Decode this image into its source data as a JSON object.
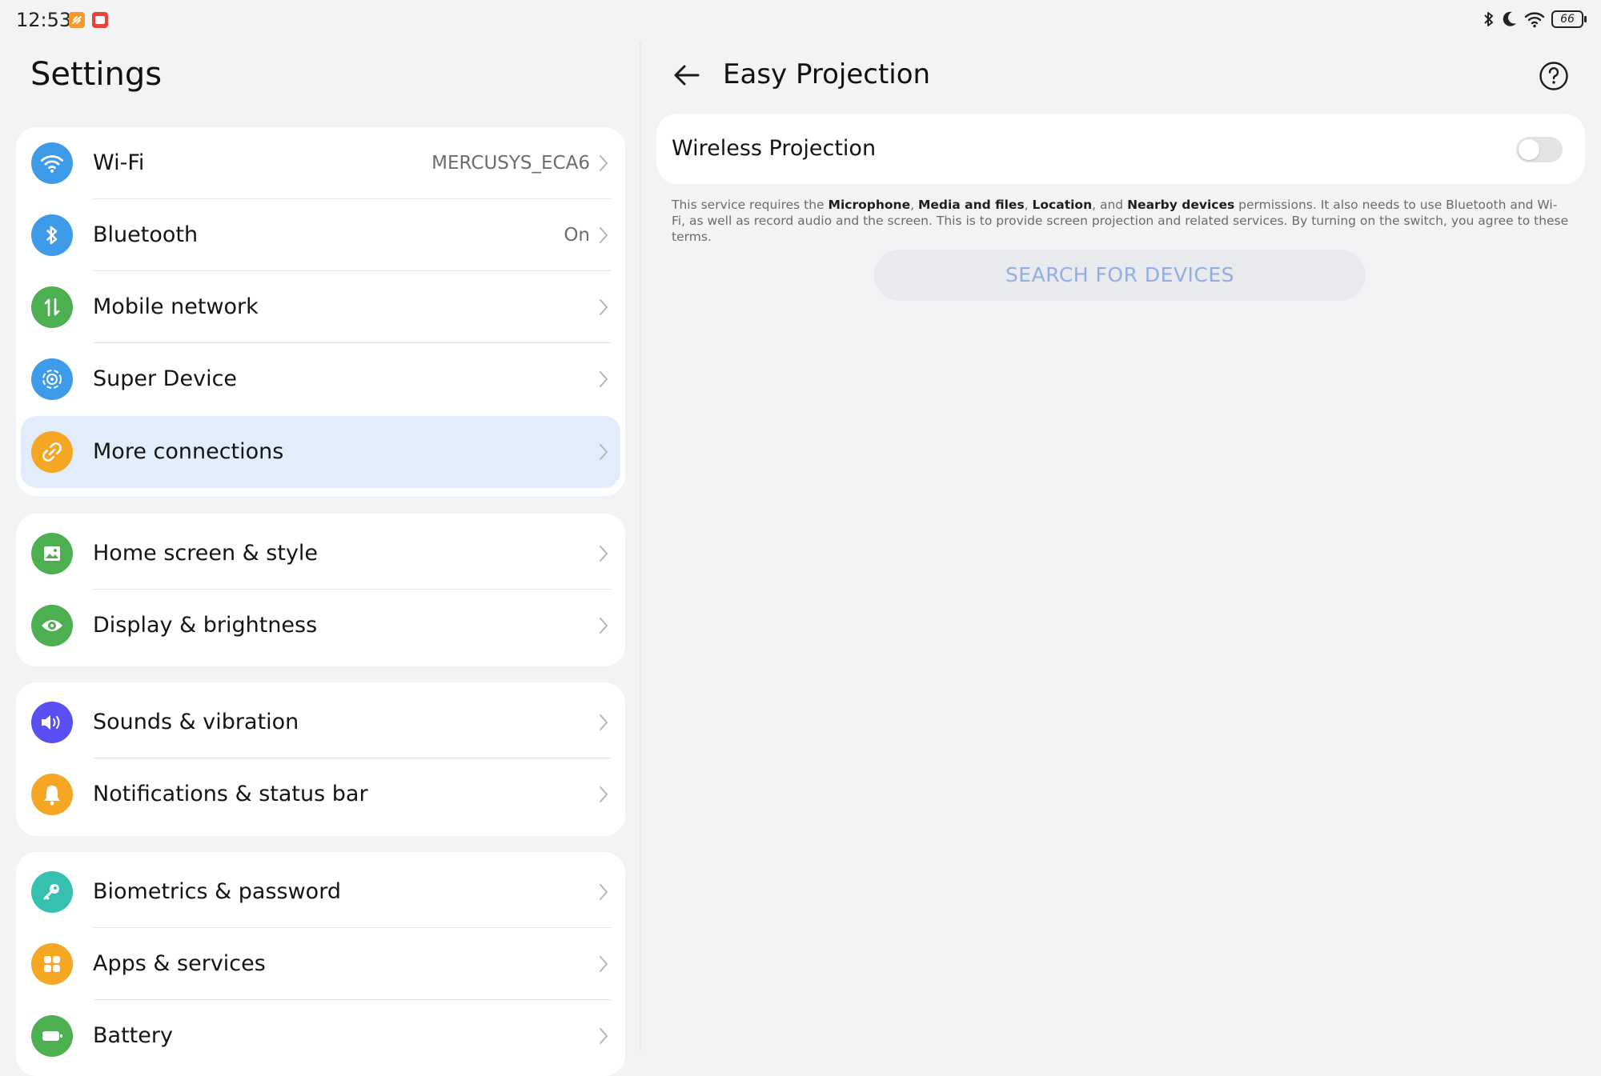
{
  "status_bar": {
    "time": "12:53",
    "notification_icons": [
      "orange-app-icon",
      "red-app-icon"
    ],
    "system_icons": [
      "bluetooth-icon",
      "moon-icon",
      "wifi-icon",
      "battery-icon"
    ],
    "battery_level": "66"
  },
  "settings": {
    "title": "Settings",
    "groups": [
      {
        "items": [
          {
            "label": "Wi-Fi",
            "value": "MERCUSYS_ECA6",
            "icon": "wifi-icon",
            "color": "#3d9be9"
          },
          {
            "label": "Bluetooth",
            "value": "On",
            "icon": "bluetooth-icon",
            "color": "#3d9be9"
          },
          {
            "label": "Mobile network",
            "value": "",
            "icon": "mobile-data-icon",
            "color": "#4caf50"
          },
          {
            "label": "Super Device",
            "value": "",
            "icon": "super-device-icon",
            "color": "#3d9be9"
          },
          {
            "label": "More connections",
            "value": "",
            "icon": "link-icon",
            "color": "#f5a623",
            "selected": true
          }
        ]
      },
      {
        "items": [
          {
            "label": "Home screen & style",
            "value": "",
            "icon": "image-icon",
            "color": "#4caf50"
          },
          {
            "label": "Display & brightness",
            "value": "",
            "icon": "eye-icon",
            "color": "#4caf50"
          }
        ]
      },
      {
        "items": [
          {
            "label": "Sounds & vibration",
            "value": "",
            "icon": "speaker-icon",
            "color": "#5a4ff2"
          },
          {
            "label": "Notifications & status bar",
            "value": "",
            "icon": "bell-icon",
            "color": "#f5a623"
          }
        ]
      },
      {
        "items": [
          {
            "label": "Biometrics & password",
            "value": "",
            "icon": "key-icon",
            "color": "#35c0b0"
          },
          {
            "label": "Apps & services",
            "value": "",
            "icon": "apps-icon",
            "color": "#f5a623"
          },
          {
            "label": "Battery",
            "value": "",
            "icon": "battery-icon",
            "color": "#4caf50"
          }
        ]
      }
    ]
  },
  "detail": {
    "title": "Easy Projection",
    "wireless_projection": {
      "label": "Wireless Projection",
      "enabled": false
    },
    "disclaimer": {
      "p1": "This service requires the ",
      "b1": "Microphone",
      "p2": ", ",
      "b2": "Media and files",
      "p3": ", ",
      "b3": "Location",
      "p4": ", and ",
      "b4": "Nearby devices",
      "p5": " permissions. It also needs to use Bluetooth and Wi-Fi, as well as record audio and the screen. This is to provide screen projection and related services. By turning on the switch, you agree to these terms."
    },
    "search_button": "SEARCH FOR DEVICES"
  }
}
